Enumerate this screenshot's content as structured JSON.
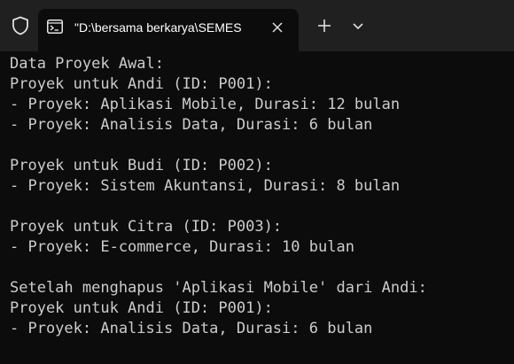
{
  "tab": {
    "title": "\"D:\\bersama berkarya\\SEMES",
    "icon": "terminal-icon"
  },
  "titlebar": {
    "shield_icon": "shield-icon",
    "close_icon": "close-icon",
    "new_tab_icon": "plus-icon",
    "dropdown_icon": "chevron-down-icon"
  },
  "colors": {
    "titlebar_bg": "#202020",
    "terminal_bg": "#0c0c0c",
    "text": "#cccccc"
  },
  "terminal": {
    "lines": [
      "Data Proyek Awal:",
      "Proyek untuk Andi (ID: P001):",
      "- Proyek: Aplikasi Mobile, Durasi: 12 bulan",
      "- Proyek: Analisis Data, Durasi: 6 bulan",
      "",
      "Proyek untuk Budi (ID: P002):",
      "- Proyek: Sistem Akuntansi, Durasi: 8 bulan",
      "",
      "Proyek untuk Citra (ID: P003):",
      "- Proyek: E-commerce, Durasi: 10 bulan",
      "",
      "Setelah menghapus 'Aplikasi Mobile' dari Andi:",
      "Proyek untuk Andi (ID: P001):",
      "- Proyek: Analisis Data, Durasi: 6 bulan"
    ]
  }
}
